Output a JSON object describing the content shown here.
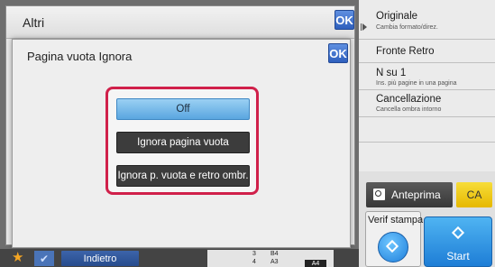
{
  "background_window": {
    "title": "Altri",
    "ok_label": "OK"
  },
  "dialog": {
    "title": "Pagina vuota Ignora",
    "ok_label": "OK",
    "options": [
      {
        "label": "Off",
        "selected": true
      },
      {
        "label": "Ignora pagina vuota",
        "selected": false
      },
      {
        "label": "Ignora p. vuota e retro ombr.",
        "selected": false
      }
    ]
  },
  "sidebar": {
    "items": [
      {
        "label": "Originale",
        "sub": "Cambia formato/direz."
      },
      {
        "label": "Fronte Retro",
        "sub": ""
      },
      {
        "label": "N su 1",
        "sub": "Ins. più pagine in una pagina"
      },
      {
        "label": "Cancellazione",
        "sub": "Cancella ombra intorno"
      }
    ]
  },
  "actions": {
    "preview_label": "Anteprima",
    "ca_label": "CA",
    "verify_label": "Verif stampa",
    "start_label": "Start"
  },
  "bottom_bar": {
    "back_label": "Indietro",
    "trays": [
      {
        "number": "3",
        "size": "B4"
      },
      {
        "number": "4",
        "size": "A3"
      }
    ],
    "selected_size": "A4"
  },
  "colors": {
    "accent_blue": "#2e5fbd",
    "highlight_red": "#d0204a",
    "selected_option": "#5aa6e0",
    "ca_yellow": "#e6b800",
    "start_blue": "#1e7ed6"
  },
  "icons": {
    "star": "star-icon",
    "check": "check-icon",
    "preview": "preview-icon",
    "verify": "diamond-icon",
    "start": "diamond-icon"
  }
}
